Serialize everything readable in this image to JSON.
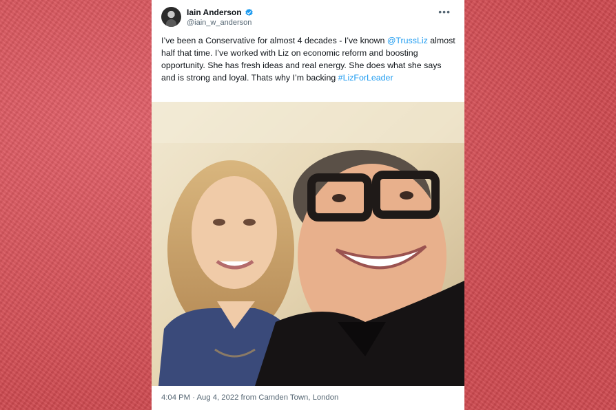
{
  "tweet": {
    "author_name": "Iain Anderson",
    "handle": "@iain_w_anderson",
    "more_label": "•••",
    "text_1": "I’ve been a Conservative for almost 4 decades - I’ve known ",
    "mention": "@TrussLiz",
    "text_2": " almost half that time. I’ve worked with Liz on economic reform and boosting opportunity. She has fresh ideas and real energy. She does what she says and is strong and loyal. Thats why I’m backing ",
    "hashtag": "#LizForLeader",
    "timestamp": "4:04 PM · Aug 4, 2022 from Camden Town, London"
  },
  "colors": {
    "background": "#d9545a",
    "link": "#1d9bf0",
    "verified": "#1d9bf0",
    "text": "#0f1419",
    "muted": "#536471"
  },
  "icons": {
    "verified": "verified-badge-icon",
    "more": "more-options-icon"
  }
}
